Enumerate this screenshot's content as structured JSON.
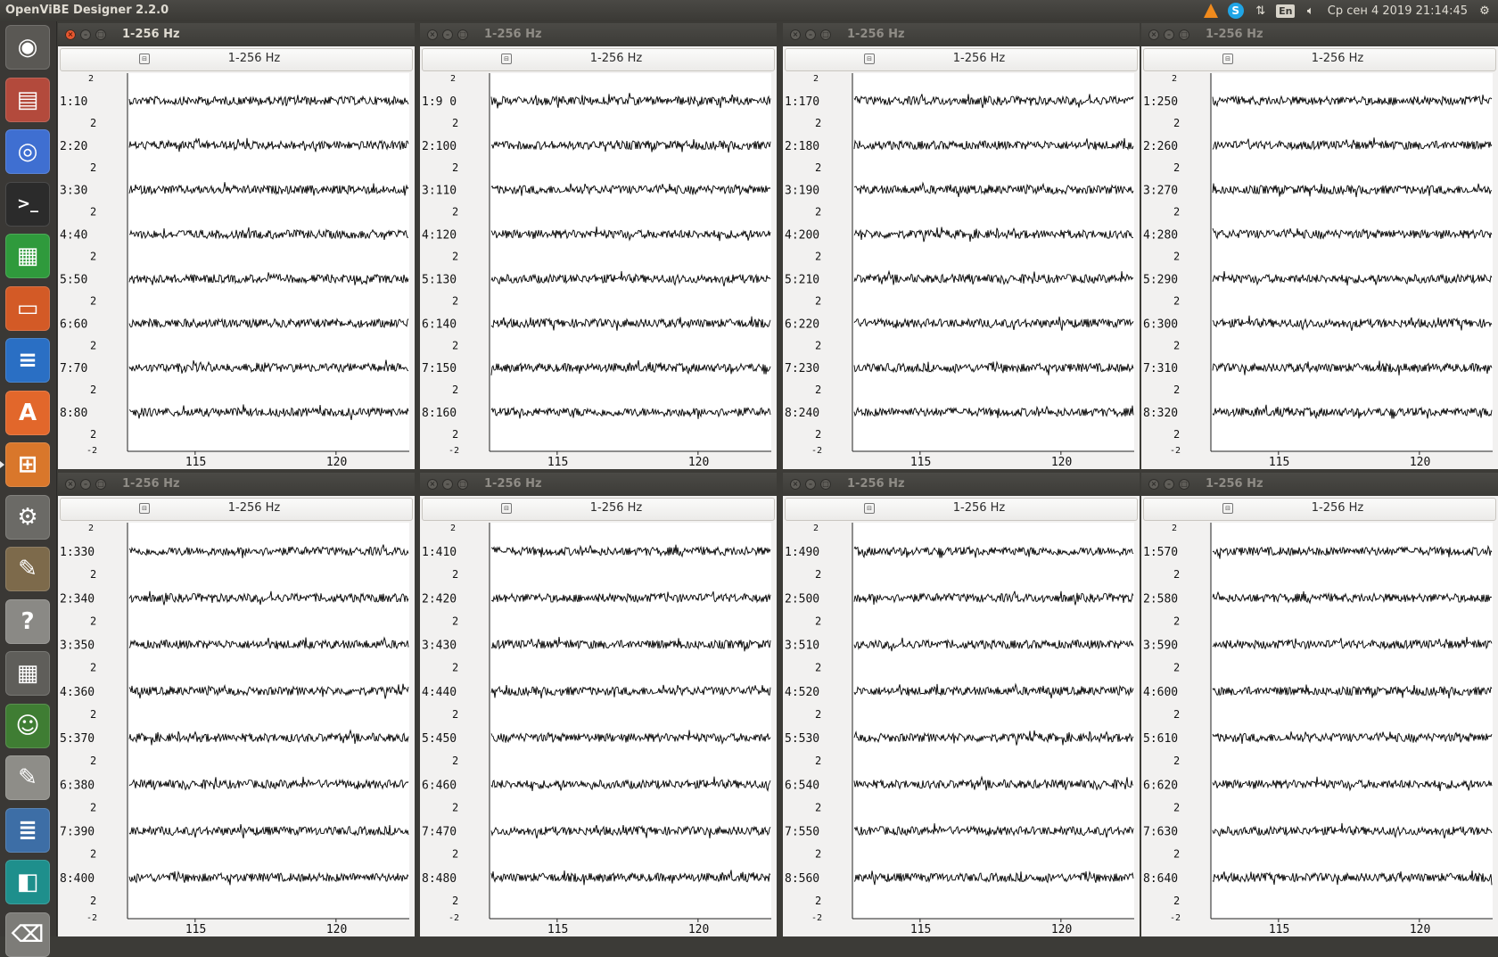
{
  "app_title": "OpenViBE Designer 2.2.0",
  "tray": {
    "language": "En",
    "datetime": "Ср сен  4 2019 21:14:45",
    "icons": [
      "vlc-icon",
      "skype-icon",
      "network-icon",
      "language-icon",
      "volume-icon",
      "settings-gear-icon"
    ]
  },
  "launcher": {
    "items": [
      {
        "name": "ubuntu-home-icon",
        "color": "#5a5854",
        "glyph": "◉"
      },
      {
        "name": "files-icon",
        "color": "#b34a3c",
        "glyph": "▤"
      },
      {
        "name": "chromium-icon",
        "color": "#3f6fd1",
        "glyph": "◎"
      },
      {
        "name": "terminal-icon",
        "color": "#2b2b2b",
        "glyph": ">_"
      },
      {
        "name": "calc-spreadsheet-icon",
        "color": "#2f9a3c",
        "glyph": "▦"
      },
      {
        "name": "impress-presentation-icon",
        "color": "#d35a26",
        "glyph": "▭"
      },
      {
        "name": "writer-document-icon",
        "color": "#2a6fc4",
        "glyph": "≡"
      },
      {
        "name": "software-center-icon",
        "color": "#e2672b",
        "glyph": "A"
      },
      {
        "name": "openvibe-designer-icon",
        "color": "#d9772b",
        "glyph": "⊞"
      },
      {
        "name": "system-settings-icon",
        "color": "#6b6a66",
        "glyph": "⚙"
      },
      {
        "name": "gimp-icon",
        "color": "#7d6a4b",
        "glyph": "✎"
      },
      {
        "name": "help-icon",
        "color": "#8a8985",
        "glyph": "?"
      },
      {
        "name": "calculator-icon",
        "color": "#5f5e5a",
        "glyph": "▦"
      },
      {
        "name": "monkey-app-icon",
        "color": "#3f7d33",
        "glyph": "☺"
      },
      {
        "name": "text-editor-icon",
        "color": "#8e8d88",
        "glyph": "✎"
      },
      {
        "name": "stacked-apps-icon",
        "color": "#3d6ea6",
        "glyph": "≣"
      },
      {
        "name": "system-monitor-icon",
        "color": "#1e8f8c",
        "glyph": "◧"
      },
      {
        "name": "trash-icon",
        "color": "#7d7c78",
        "glyph": "⌫"
      }
    ]
  },
  "windows": [
    {
      "title": "1-256 Hz",
      "subtitle": "1-256 Hz",
      "active": true,
      "channels": [
        "1:10",
        "2:20",
        "3:30",
        "4:40",
        "5:50",
        "6:60",
        "7:70",
        "8:80"
      ],
      "x_ticks": [
        "115",
        "120"
      ]
    },
    {
      "title": "1-256 Hz",
      "subtitle": "1-256 Hz",
      "active": false,
      "channels": [
        "1:9 0",
        "2:100",
        "3:110",
        "4:120",
        "5:130",
        "6:140",
        "7:150",
        "8:160"
      ],
      "x_ticks": [
        "115",
        "120"
      ]
    },
    {
      "title": "1-256 Hz",
      "subtitle": "1-256 Hz",
      "active": false,
      "channels": [
        "1:170",
        "2:180",
        "3:190",
        "4:200",
        "5:210",
        "6:220",
        "7:230",
        "8:240"
      ],
      "x_ticks": [
        "115",
        "120"
      ]
    },
    {
      "title": "1-256 Hz",
      "subtitle": "1-256 Hz",
      "active": false,
      "channels": [
        "1:250",
        "2:260",
        "3:270",
        "4:280",
        "5:290",
        "6:300",
        "7:310",
        "8:320"
      ],
      "x_ticks": [
        "115",
        "120"
      ]
    },
    {
      "title": "1-256 Hz",
      "subtitle": "1-256 Hz",
      "active": false,
      "channels": [
        "1:330",
        "2:340",
        "3:350",
        "4:360",
        "5:370",
        "6:380",
        "7:390",
        "8:400"
      ],
      "x_ticks": [
        "115",
        "120"
      ]
    },
    {
      "title": "1-256 Hz",
      "subtitle": "1-256 Hz",
      "active": false,
      "channels": [
        "1:410",
        "2:420",
        "3:430",
        "4:440",
        "5:450",
        "6:460",
        "7:470",
        "8:480"
      ],
      "x_ticks": [
        "115",
        "120"
      ]
    },
    {
      "title": "1-256 Hz",
      "subtitle": "1-256 Hz",
      "active": false,
      "channels": [
        "1:490",
        "2:500",
        "3:510",
        "4:520",
        "5:530",
        "6:540",
        "7:550",
        "8:560"
      ],
      "x_ticks": [
        "115",
        "120"
      ]
    },
    {
      "title": "1-256 Hz",
      "subtitle": "1-256 Hz",
      "active": false,
      "channels": [
        "1:570",
        "2:580",
        "3:590",
        "4:600",
        "5:610",
        "6:620",
        "7:630",
        "8:640"
      ],
      "x_ticks": [
        "115",
        "120"
      ]
    }
  ],
  "between_label": "2",
  "top_label": "2",
  "bottom_label": "-2"
}
